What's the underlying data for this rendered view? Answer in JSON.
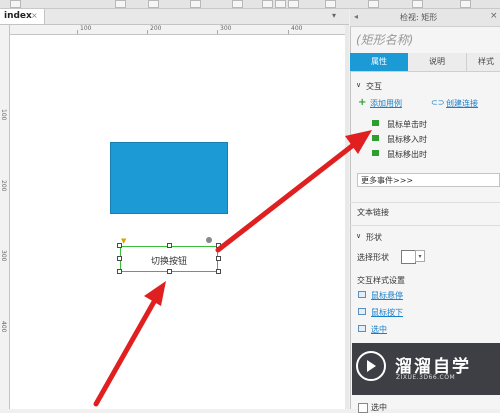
{
  "colors": {
    "accent": "#1c9ad6",
    "arrow": "#e02020",
    "selection": "#37c037",
    "link": "#1a7fc9"
  },
  "document_tab": {
    "label": "index",
    "close": "×"
  },
  "ruler": {
    "h_labels": [
      "100",
      "200",
      "300",
      "400"
    ],
    "v_labels": [
      "100",
      "200",
      "300",
      "400"
    ]
  },
  "canvas": {
    "button_text": "切换按钮"
  },
  "inspector": {
    "header_title": "检视: 矩形",
    "shape_name_placeholder": "(矩形名称)",
    "tabs": [
      {
        "label": "属性"
      },
      {
        "label": "说明"
      },
      {
        "label": "样式"
      }
    ],
    "interaction": {
      "section_label": "交互",
      "add_case": "添加用例",
      "create_link": "创建连接",
      "events": [
        "鼠标单击时",
        "鼠标移入时",
        "鼠标移出时"
      ],
      "more_events": "更多事件>>>"
    },
    "text_link": "文本链接",
    "shape": {
      "section_label": "形状",
      "select_shape": "选择形状",
      "interaction_style_label": "交互样式设置",
      "styles": [
        "鼠标悬停",
        "鼠标按下",
        "选中"
      ]
    },
    "bottom_label": "选中"
  },
  "watermark": {
    "main": "溜溜自学",
    "sub": "ZIXUE.3D66.COM"
  }
}
